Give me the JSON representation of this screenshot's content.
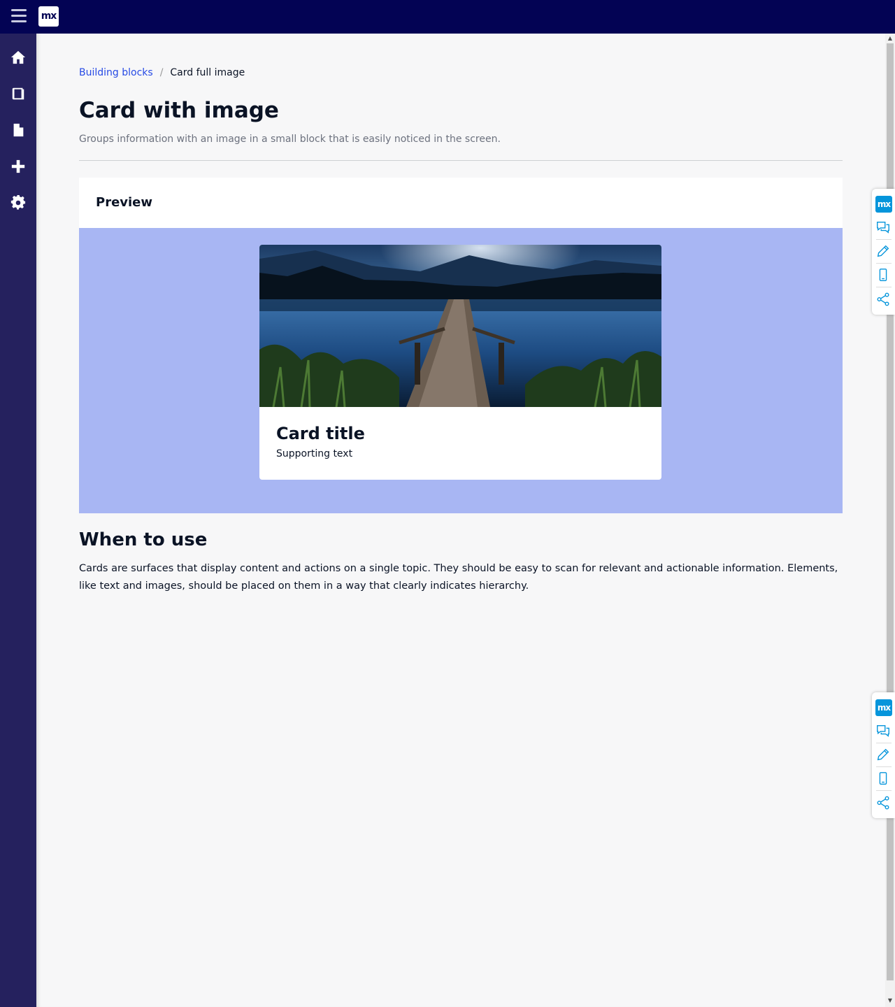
{
  "topbar": {
    "logo_text": "mx"
  },
  "sidenav": {
    "icons": [
      "home-icon",
      "book-icon",
      "file-icon",
      "plus-icon",
      "gear-icon"
    ]
  },
  "breadcrumb": {
    "parent": "Building blocks",
    "separator": "/",
    "current": "Card full image"
  },
  "page": {
    "title": "Card with image",
    "subtitle": "Groups information with an image in a small block that is easily noticed in the screen."
  },
  "preview": {
    "heading": "Preview",
    "card": {
      "title": "Card title",
      "text": "Supporting text"
    }
  },
  "when_to_use": {
    "heading": "When to use",
    "text": "Cards are surfaces that display content and actions on a single topic. They should be easy to scan for relevant and actionable information. Elements, like text and images, should be placed on them in a way that clearly indicates hierarchy."
  },
  "widget": {
    "logo_text": "mx",
    "icons": [
      "chat-icon",
      "pencil-icon",
      "mobile-icon",
      "share-icon"
    ]
  },
  "colors": {
    "topbar": "#030354",
    "sidenav": "#25215e",
    "link": "#264ae5",
    "preview_bg": "#a8b6f3",
    "widget_accent": "#0595db"
  }
}
